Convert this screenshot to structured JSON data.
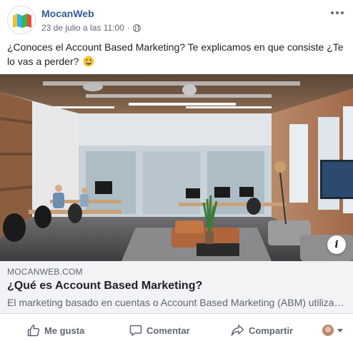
{
  "post": {
    "page_name": "MocanWeb",
    "timestamp": "23 de julio a las 11:00",
    "separator": "·",
    "privacy_icon": "globe-icon",
    "text": "¿Conoces el Account Based Marketing? Te explicamos en que consiste ¿Te lo vas a perder?",
    "text_emoji": "grinning-face-emoji"
  },
  "link_preview": {
    "domain": "MOCANWEB.COM",
    "title": "¿Qué es Account Based Marketing?",
    "description": "El marketing basado en cuentas o Account Based Marketing (ABM) utiliza…",
    "info_label": "i"
  },
  "actions": {
    "like": "Me gusta",
    "comment": "Comentar",
    "share": "Compartir"
  },
  "colors": {
    "page_name": "#385898",
    "secondary_text": "#606770",
    "link_box_bg": "#f2f3f5",
    "logo_colors": [
      "#f2c12e",
      "#2bb3e6",
      "#39b54a",
      "#e94b3c"
    ]
  }
}
